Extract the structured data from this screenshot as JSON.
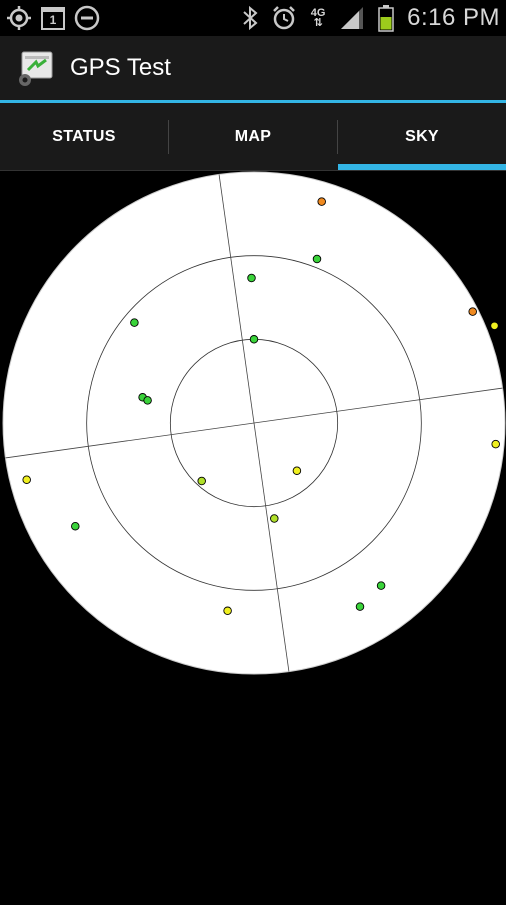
{
  "status_bar": {
    "time": "6:16 PM",
    "network": "4G",
    "left_icons": [
      "gps-icon",
      "calendar-icon",
      "do-not-disturb-icon"
    ],
    "right_icons": [
      "bluetooth-icon",
      "alarm-icon",
      "network-4g-icon",
      "signal-icon",
      "battery-icon"
    ],
    "calendar_day": "1",
    "battery_color": "#9ccc1c"
  },
  "app_bar": {
    "title": "GPS Test"
  },
  "tabs": [
    {
      "label": "STATUS",
      "selected": false
    },
    {
      "label": "MAP",
      "selected": false
    },
    {
      "label": "SKY",
      "selected": true
    }
  ],
  "colors": {
    "accent": "#33b5e5",
    "satellite_green": "#3ad33a",
    "satellite_yellowgreen": "#b0e02a",
    "satellite_yellow": "#f0f020",
    "satellite_orange": "#f08a20"
  },
  "sky": {
    "rotation_deg": -8,
    "elevation_rings_deg": [
      0,
      30,
      60
    ],
    "satellites": [
      {
        "azimuth": 25,
        "elevation": 7,
        "color": "orange"
      },
      {
        "azimuth": 7,
        "elevation": 38,
        "color": "green"
      },
      {
        "azimuth": 29,
        "elevation": 27,
        "color": "green"
      },
      {
        "azimuth": 8,
        "elevation": 60,
        "color": "green"
      },
      {
        "azimuth": 318,
        "elevation": 34,
        "color": "green"
      },
      {
        "azimuth": 291,
        "elevation": 49,
        "color": "green"
      },
      {
        "azimuth": 290,
        "elevation": 51,
        "color": "green"
      },
      {
        "azimuth": 71,
        "elevation": 2,
        "color": "orange"
      },
      {
        "azimuth": 76,
        "elevation": -3,
        "color": "yellow"
      },
      {
        "azimuth": 103,
        "elevation": 3,
        "color": "yellow"
      },
      {
        "azimuth": 146,
        "elevation": 67,
        "color": "yellow"
      },
      {
        "azimuth": 230,
        "elevation": 62,
        "color": "yellowgreen"
      },
      {
        "azimuth": 264,
        "elevation": 6,
        "color": "yellow"
      },
      {
        "azimuth": 248,
        "elevation": 16,
        "color": "green"
      },
      {
        "azimuth": 176,
        "elevation": 55,
        "color": "yellowgreen"
      },
      {
        "azimuth": 196,
        "elevation": 22,
        "color": "yellow"
      },
      {
        "azimuth": 158,
        "elevation": 14,
        "color": "green"
      },
      {
        "azimuth": 150,
        "elevation": 16,
        "color": "green"
      }
    ]
  }
}
